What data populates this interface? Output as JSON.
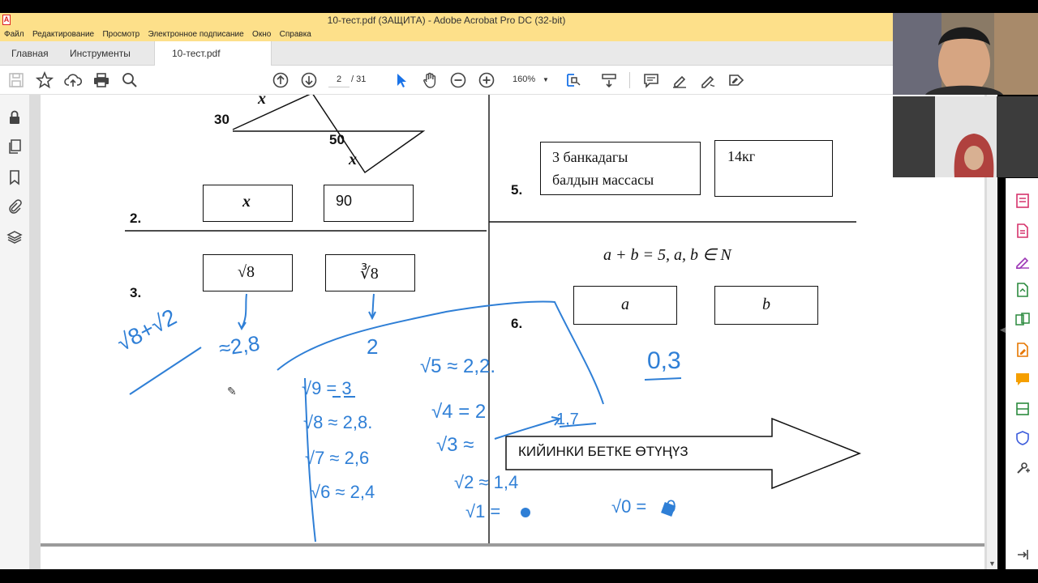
{
  "window": {
    "title": "10-тест.pdf (ЗАЩИТА) - Adobe Acrobat Pro DC (32-bit)"
  },
  "menu": {
    "items": [
      "Файл",
      "Редактирование",
      "Просмотр",
      "Электронное подписание",
      "Окно",
      "Справка"
    ]
  },
  "tabs": {
    "home": "Главная",
    "tools": "Инструменты",
    "doc": "10-тест.pdf (ЗАЩИ..."
  },
  "toolbar": {
    "page_current": "2",
    "page_total": "/ 31",
    "zoom": "160%"
  },
  "doc": {
    "triangle_labels": {
      "x_top": "x",
      "a30": "30",
      "a50": "50",
      "x_bottom": "x"
    },
    "q2": {
      "num": "2.",
      "left": "x",
      "right": "90"
    },
    "q3": {
      "num": "3.",
      "left": "√8",
      "right": "∛8"
    },
    "q5": {
      "num": "5.",
      "left_line1": "3 банкадагы",
      "left_line2": "балдын массасы",
      "right": "14кг"
    },
    "q6": {
      "num": "6.",
      "condition": "a + b = 5, a, b ∈ N",
      "left": "a",
      "right": "b"
    },
    "arrow_text": "КИЙИНКИ БЕТКЕ ӨТҮҢҮЗ"
  },
  "ink": {
    "sum": "√8+√2",
    "approx28": "≈2,8",
    "two": "2",
    "r9": "√9 = 3",
    "r8": "√8 ≈ 2,8.",
    "r7": "√7 ≈ 2,6",
    "r6": "√6 ≈ 2,4",
    "r5": "√5 ≈ 2,2.",
    "r4": "√4 = 2",
    "r3": "√3 ≈",
    "r3val": "1,7",
    "r2": "√2 ≈ 1,4",
    "r1": "√1 =",
    "r0": "√0 = ",
    "r0val": "0",
    "q6ans": "0,3"
  },
  "colors": {
    "ink": "#2f7fd6",
    "titlebar": "#fde08a",
    "accent": "#1a73e8"
  }
}
